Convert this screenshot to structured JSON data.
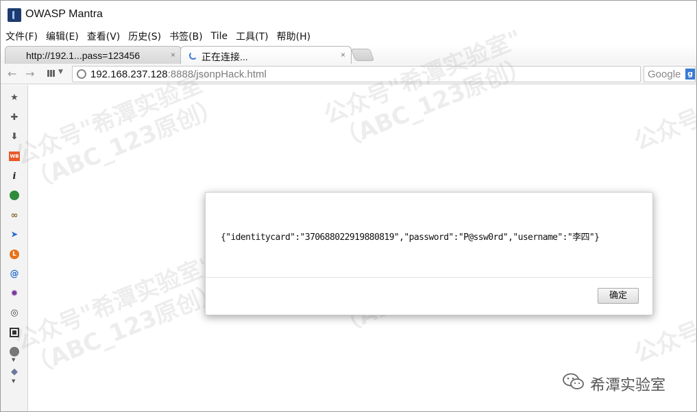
{
  "window": {
    "title": "OWASP Mantra"
  },
  "menu": [
    "文件(F)",
    "编辑(E)",
    "查看(V)",
    "历史(S)",
    "书签(B)",
    "Tile",
    "工具(T)",
    "帮助(H)"
  ],
  "tabs": [
    {
      "label": "http://192.1...pass=123456",
      "close": "×"
    },
    {
      "label": "正在连接...",
      "close": "×"
    }
  ],
  "nav": {
    "back": "←",
    "forward": "→",
    "url_host": "192.168.237.128",
    "url_rest": ":8888/jsonpHack.html",
    "search_label": "Google",
    "search_engine_glyph": "g"
  },
  "sidebar_icons": [
    "star-icon",
    "puzzle-icon",
    "download-icon",
    "wb-icon",
    "info-icon",
    "shield-icon",
    "link-icon",
    "cursor-icon",
    "l-icon",
    "swirl-icon",
    "gear-purple-icon",
    "palette-icon",
    "qr-icon",
    "skull-icon",
    "tag-icon"
  ],
  "dialog": {
    "message": "{\"identitycard\":\"370688022919880819\",\"password\":\"P@ssw0rd\",\"username\":\"李四\"}",
    "ok_label": "确定"
  },
  "watermark": {
    "line1": "公众号\"希潭实验室\"",
    "line2": "（ABC_123原创）"
  },
  "brand": {
    "name": "希潭实验室"
  },
  "colors": {
    "accent": "#3a7bd5",
    "title_icon": "#1d3b6e"
  }
}
